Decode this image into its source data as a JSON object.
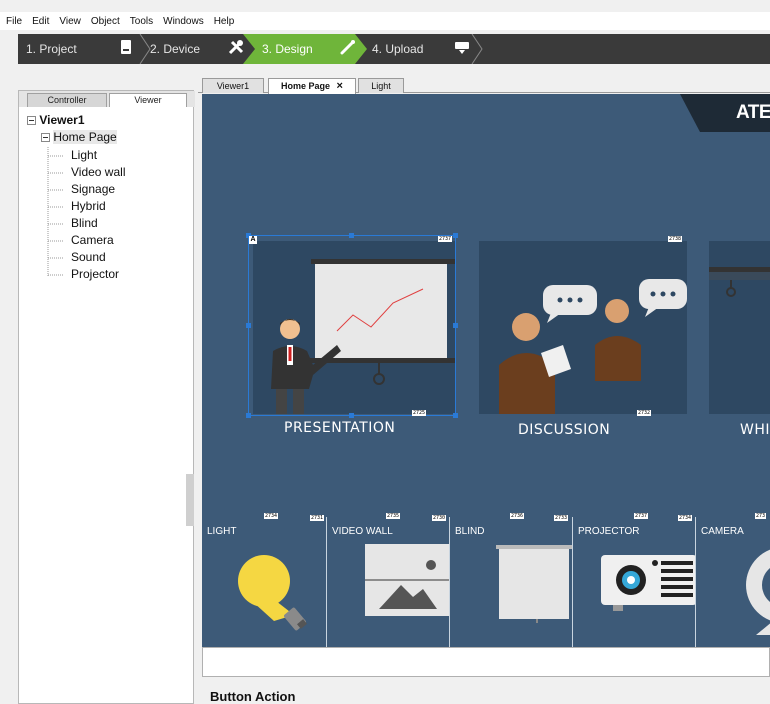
{
  "menu": [
    "File",
    "Edit",
    "View",
    "Object",
    "Tools",
    "Windows",
    "Help"
  ],
  "steps": [
    {
      "label": "1. Project",
      "icon": "document-icon"
    },
    {
      "label": "2. Device",
      "icon": "tools-icon"
    },
    {
      "label": "3. Design",
      "icon": "brush-icon",
      "active": true
    },
    {
      "label": "4. Upload",
      "icon": "upload-icon"
    }
  ],
  "left_tabs": [
    "Controller",
    "Viewer"
  ],
  "tree": {
    "root": "Viewer1",
    "page": "Home Page",
    "children": [
      "Light",
      "Video wall",
      "Signage",
      "Hybrid",
      "Blind",
      "Camera",
      "Sound",
      "Projector"
    ]
  },
  "editor_tabs": [
    {
      "label": "Viewer1"
    },
    {
      "label": "Home Page",
      "selected": true,
      "close": "×"
    },
    {
      "label": "Light"
    }
  ],
  "canvas": {
    "logo": "ATEN",
    "scenes": [
      {
        "label": "PRESENTATION",
        "tag_top": "2737",
        "tag_bottom": "2725",
        "corner": "A"
      },
      {
        "label": "DISCUSSION",
        "tag_top": "2738",
        "tag_bottom": "2732"
      },
      {
        "label": "WHI"
      }
    ],
    "buttons": [
      {
        "label": "LIGHT",
        "tag_a": "2734",
        "tag_b": "2731"
      },
      {
        "label": "VIDEO WALL",
        "tag_a": "2735",
        "tag_b": "2730"
      },
      {
        "label": "BLIND",
        "tag_a": "2736",
        "tag_b": "2733"
      },
      {
        "label": "PROJECTOR",
        "tag_a": "2737",
        "tag_b": "2734"
      },
      {
        "label": "CAMERA",
        "tag_a": "273"
      }
    ]
  },
  "panel": {
    "title": "Button Action"
  },
  "colors": {
    "canvas_bg": "#3d5a78",
    "scene_bg": "#2e4862",
    "active_step": "#6fb53a",
    "steps_bar": "#3a3a3a"
  }
}
